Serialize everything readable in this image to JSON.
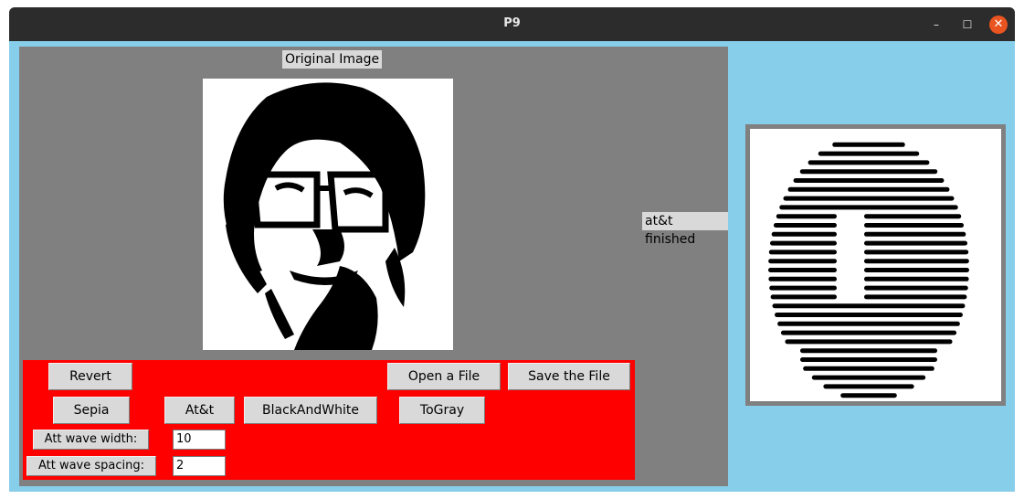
{
  "window": {
    "title": "P9"
  },
  "titlebar": {
    "minimize_glyph": "–",
    "maximize_glyph": "☐",
    "close_glyph": "✕"
  },
  "original": {
    "label": "Original Image"
  },
  "status": {
    "text": "at&t finished"
  },
  "buttons": {
    "revert": "Revert",
    "open": "Open a File",
    "save": "Save the File",
    "sepia": "Sepia",
    "att": "At&t",
    "bw": "BlackAndWhite",
    "togray": "ToGray"
  },
  "fields": {
    "wave_width_label": "Att wave width:",
    "wave_width_value": "10",
    "wave_spacing_label": "Att wave spacing:",
    "wave_spacing_value": "2"
  },
  "colors": {
    "panel": "#808080",
    "controls": "#ff0000",
    "background": "#87ceeb"
  }
}
